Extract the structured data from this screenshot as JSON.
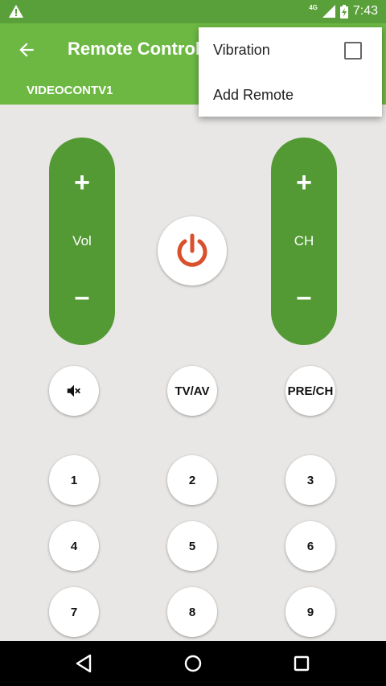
{
  "status_bar": {
    "time": "7:43",
    "network": "4G",
    "icons": [
      "warning-icon",
      "signal-icon",
      "battery-charging-icon"
    ]
  },
  "app_bar": {
    "title": "Remote Control",
    "back_icon": "arrow-back-icon"
  },
  "tab": {
    "label": "VIDEOCONTV1"
  },
  "remote": {
    "volume": {
      "plus": "+",
      "label": "Vol",
      "minus": "–"
    },
    "channel": {
      "plus": "+",
      "label": "CH",
      "minus": "–"
    },
    "power_icon": "power-icon",
    "mute_icon": "mute-icon",
    "tv_av_label": "TV/AV",
    "pre_ch_label": "PRE/CH",
    "keys": [
      "1",
      "2",
      "3",
      "4",
      "5",
      "6",
      "7",
      "8",
      "9"
    ]
  },
  "overflow_menu": {
    "vibration_label": "Vibration",
    "vibration_checked": false,
    "add_remote_label": "Add Remote"
  },
  "nav_bar": {
    "icons": [
      "back-triangle-icon",
      "home-circle-icon",
      "recents-square-icon"
    ]
  },
  "colors": {
    "status_bar": "#5aa03a",
    "app_bar": "#6cb843",
    "rocker": "#539a35",
    "power_accent": "#d9502c",
    "background": "#e9e7e5"
  }
}
